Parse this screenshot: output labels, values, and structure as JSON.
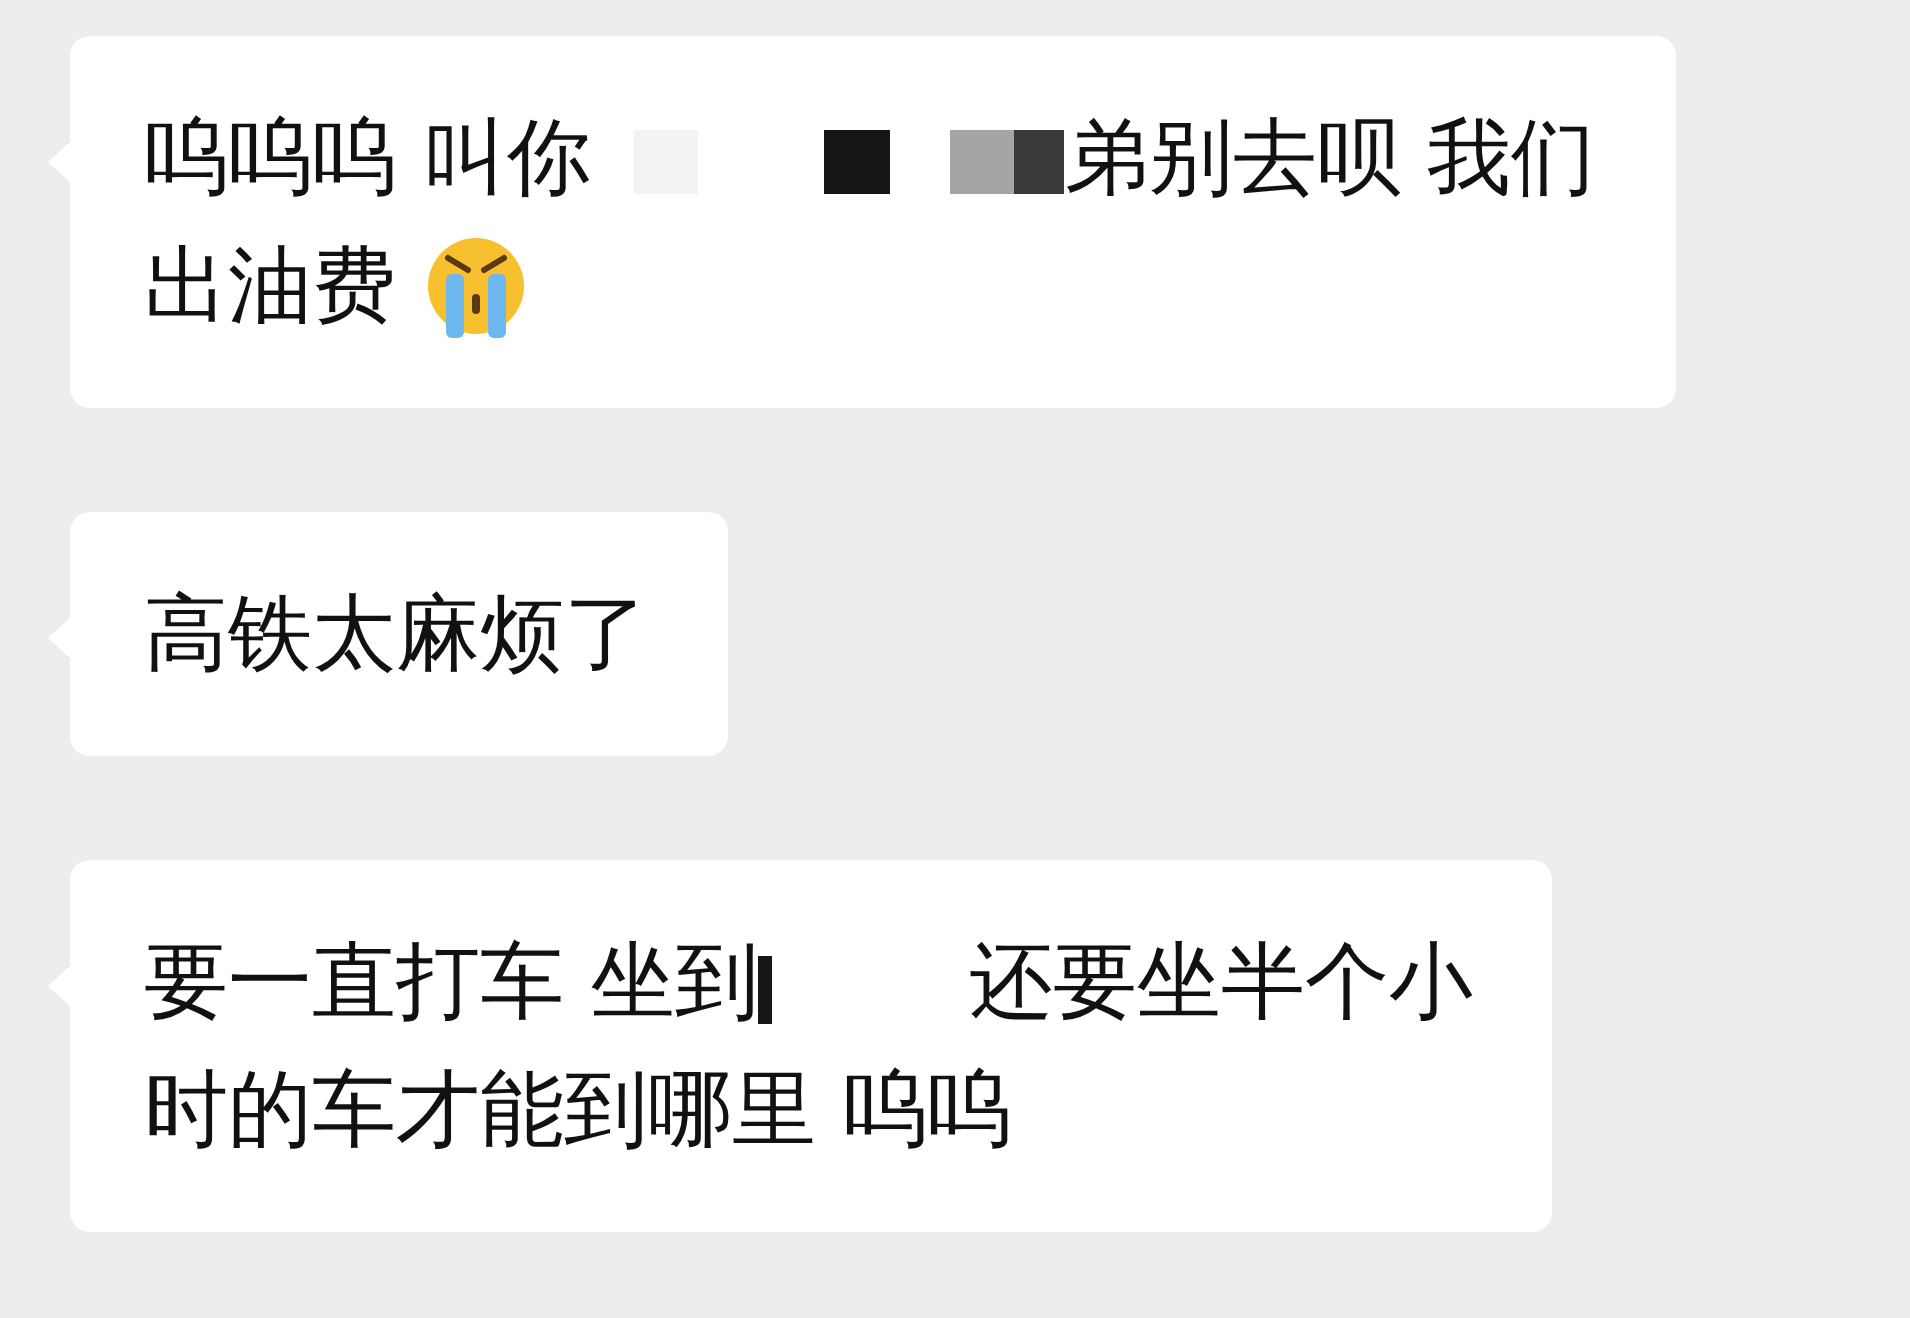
{
  "messages": [
    {
      "lines": [
        [
          {
            "kind": "text",
            "text": "呜呜呜 叫你"
          },
          {
            "kind": "mosaic"
          },
          {
            "kind": "text",
            "text": "弟别去呗 我们"
          }
        ],
        [
          {
            "kind": "text",
            "text": "出油费"
          },
          {
            "kind": "emoji"
          }
        ]
      ]
    },
    {
      "lines": [
        [
          {
            "kind": "text",
            "text": "高铁太麻烦了"
          }
        ]
      ]
    },
    {
      "lines": [
        [
          {
            "kind": "text",
            "text": "要一直打车 坐到"
          },
          {
            "kind": "stub"
          },
          {
            "kind": "text",
            "text": "还要坐半个小"
          }
        ],
        [
          {
            "kind": "text",
            "text": "时的车才能到哪里 呜呜"
          }
        ]
      ]
    }
  ]
}
